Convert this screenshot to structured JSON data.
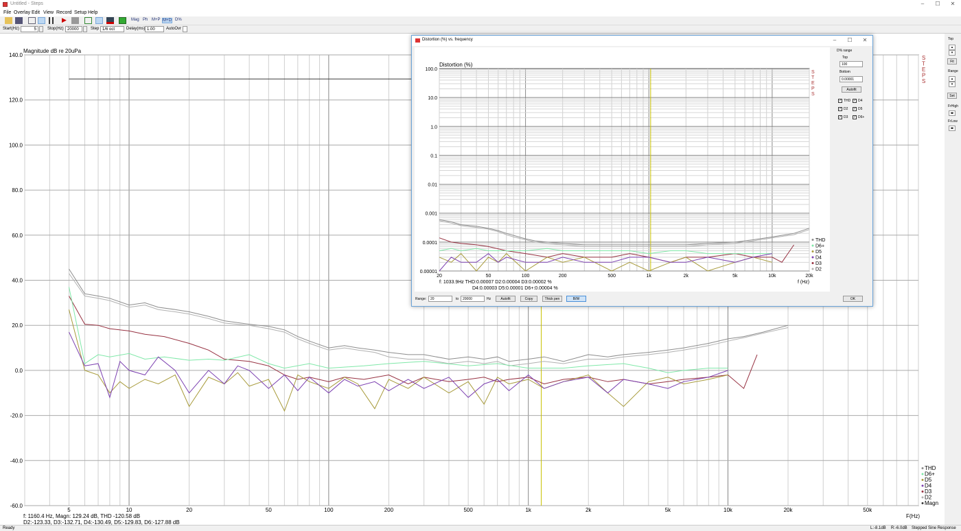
{
  "window": {
    "title": "Untitled - Steps"
  },
  "menu": [
    "File",
    "Overlay",
    "Edit",
    "View",
    "Record",
    "Setup",
    "Help"
  ],
  "toolbar": {
    "mag_label": "Mag",
    "ph_label": "Ph",
    "mp_label": "M+P",
    "md_label": "M+D",
    "pct_label": "D%"
  },
  "params": {
    "start_label": "Start(Hz)",
    "start_value": "5",
    "stop_label": "Stop(Hz)",
    "stop_value": "20000",
    "step_label": "Step",
    "step_value": "1/6 oct",
    "delay_label": "Delay(ms)",
    "delay_value": "1.00",
    "autoovr_label": "AutoOvr"
  },
  "right_panel": {
    "top_label": "Top",
    "fit_label": "Fit",
    "range_label": "Range",
    "set_label": "Set",
    "frhigh_label": "FrHigh",
    "frlow_label": "FrLow"
  },
  "status": {
    "left": "Ready",
    "lvl_l": "L:-8.1dB",
    "lvl_r": "R:-6.0dB",
    "mode": "Stepped Sine Response"
  },
  "colors": {
    "thd": "#8c8c8c",
    "magn": "#3a3a3a",
    "d6": "#7fe8a8",
    "d5": "#a79a3a",
    "d4": "#7b3fb0",
    "d3": "#963040",
    "d2": "#b0b0b0",
    "marker": "#c8c000",
    "steps_logo": "#a33"
  },
  "chart_data": [
    {
      "type": "line",
      "ylabel": "Magnitude dB re 20uPa",
      "xlabel": "F(Hz)",
      "xscale": "log",
      "xlim": [
        3.0,
        90000
      ],
      "ylim": [
        -60,
        140
      ],
      "x_ticks": [
        "5",
        "10",
        "20",
        "50",
        "100",
        "200",
        "500",
        "1k",
        "2k",
        "5k",
        "10k",
        "20k",
        "50k"
      ],
      "y_ticks": [
        "140.0",
        "120.0",
        "100.0",
        "80.0",
        "60.0",
        "40.0",
        "20.0",
        "0.0",
        "-20.0",
        "-40.0",
        "-60.0"
      ],
      "marker_x": 1160.4,
      "legend": [
        "THD",
        "D6+",
        "D5",
        "D4",
        "D3",
        "D2",
        "Magn"
      ],
      "legend_position": "bottom-right",
      "logo": "STEPS",
      "readout_line1": "f: 1160.4 Hz, Magn: 129.24 dB, THD -120.58  dB",
      "readout_line2": "D2:-123.33, D3:-132.71, D4:-130.49, D5:-129.83, D6:-127.88 dB",
      "series": [
        {
          "name": "Magn",
          "x": [
            5,
            10,
            20,
            50,
            100,
            200,
            500,
            1000,
            2000,
            5000,
            10000,
            15000
          ],
          "y": [
            129.3,
            129.3,
            129.3,
            129.3,
            129.3,
            129.3,
            129.3,
            129.3,
            129.3,
            129.3,
            129.3,
            129.3
          ]
        },
        {
          "name": "THD",
          "x": [
            5,
            6,
            7,
            8,
            10,
            12,
            14,
            17,
            20,
            25,
            30,
            40,
            50,
            60,
            70,
            80,
            100,
            120,
            140,
            170,
            200,
            250,
            300,
            400,
            500,
            600,
            700,
            800,
            1000,
            1200,
            1500,
            2000,
            2500,
            3000,
            4000,
            5000,
            6000,
            8000,
            10000,
            12000,
            15000,
            20000
          ],
          "y": [
            45,
            34,
            33,
            32,
            29,
            30,
            28,
            27,
            26,
            24,
            22,
            20.5,
            19.5,
            18,
            15,
            13,
            10,
            11,
            10,
            9,
            8,
            7,
            7,
            5,
            6,
            5,
            6,
            4,
            5,
            6,
            4,
            7,
            6,
            7,
            8,
            9,
            10,
            12,
            14,
            15,
            17,
            20
          ]
        },
        {
          "name": "D2",
          "x": [
            5,
            6,
            7,
            8,
            10,
            12,
            14,
            17,
            20,
            25,
            30,
            40,
            50,
            60,
            70,
            80,
            100,
            120,
            140,
            170,
            200,
            250,
            300,
            400,
            500,
            600,
            700,
            800,
            1000,
            1200,
            1500,
            2000,
            2500,
            3000,
            4000,
            5000,
            6000,
            8000,
            10000,
            12000,
            15000,
            20000
          ],
          "y": [
            43,
            33,
            32,
            31,
            28,
            29,
            27,
            26,
            25,
            23,
            21,
            20,
            18.5,
            17,
            14,
            12,
            9,
            10,
            9,
            8,
            6,
            5,
            5,
            3,
            4,
            3,
            4,
            2,
            3,
            4,
            3,
            5,
            5,
            6,
            7,
            8,
            9,
            11,
            13,
            14.5,
            16.5,
            19
          ]
        },
        {
          "name": "D3",
          "x": [
            5,
            6,
            7,
            8,
            10,
            12,
            15,
            20,
            25,
            30,
            40,
            50,
            60,
            70,
            80,
            100,
            120,
            150,
            200,
            250,
            300,
            400,
            500,
            600,
            700,
            800,
            1000,
            1200,
            1500,
            2000,
            2500,
            3000,
            4000,
            5000,
            6000,
            8000,
            10000,
            12000,
            14000
          ],
          "y": [
            33,
            20.5,
            20,
            18.5,
            17.5,
            16,
            15,
            12,
            9,
            5,
            4,
            2,
            -2,
            -4,
            -3,
            -5,
            -3,
            -4,
            -2,
            -6,
            -3,
            -5,
            -4,
            -3,
            -5,
            -4,
            -3,
            -6,
            -4,
            -3,
            -5,
            -4,
            -6,
            -5,
            -4,
            -3,
            -2,
            -8,
            7
          ]
        },
        {
          "name": "D6+",
          "x": [
            5,
            6,
            7,
            8,
            10,
            12,
            15,
            20,
            25,
            30,
            40,
            50,
            60,
            80,
            100,
            150,
            200,
            300,
            500,
            700,
            1000,
            1500,
            2000,
            3000,
            4000,
            5000,
            6000,
            8000,
            10000
          ],
          "y": [
            37,
            3,
            7,
            6,
            7.5,
            5,
            6,
            4.5,
            5,
            4.5,
            7,
            3,
            1,
            3,
            1,
            2,
            3,
            4,
            2,
            3,
            1,
            1,
            2,
            3,
            1,
            -1,
            0,
            1,
            1
          ]
        },
        {
          "name": "D5",
          "x": [
            5,
            6,
            7,
            8,
            9,
            10,
            12,
            14,
            17,
            20,
            25,
            30,
            35,
            40,
            50,
            60,
            70,
            80,
            100,
            120,
            140,
            170,
            200,
            250,
            300,
            400,
            500,
            600,
            700,
            800,
            1000,
            1200,
            1500,
            2000,
            2500,
            3000,
            4000,
            5000,
            6000,
            8000,
            10000
          ],
          "y": [
            27,
            0,
            -2,
            -10,
            -5,
            -8,
            -4,
            -6,
            -2,
            -16,
            -3,
            -6,
            -1,
            -7,
            -4,
            -18,
            -2,
            -5,
            -8,
            -3,
            -6,
            -17,
            -4,
            -8,
            -3,
            -10,
            -5,
            -15,
            -3,
            -6,
            -4,
            -8,
            -5,
            -2,
            -10,
            -16,
            -5,
            -3,
            -6,
            -4,
            -2
          ]
        },
        {
          "name": "D4",
          "x": [
            5,
            6,
            7,
            8,
            9,
            10,
            12,
            14,
            17,
            20,
            25,
            30,
            35,
            40,
            50,
            60,
            70,
            80,
            100,
            120,
            140,
            170,
            200,
            250,
            300,
            400,
            500,
            600,
            700,
            800,
            1000,
            1200,
            1500,
            2000,
            2500,
            3000,
            4000,
            5000,
            6000,
            8000,
            10000
          ],
          "y": [
            17,
            2,
            3,
            -12,
            4,
            0,
            -2,
            6,
            0,
            -10,
            0,
            -6,
            2,
            0,
            -8,
            -2,
            -9,
            -3,
            -10,
            -4,
            -7,
            -5,
            -9,
            -4,
            -8,
            -3,
            -12,
            -6,
            -4,
            -9,
            -2,
            -8,
            -5,
            -3,
            -10,
            -4,
            -6,
            -8,
            -5,
            -3,
            0
          ]
        }
      ]
    },
    {
      "type": "line",
      "title": "Distortion (%) vs. frequency",
      "ylabel": "Distortion (%)",
      "xlabel": "f (Hz)",
      "xscale": "log",
      "yscale": "log",
      "xlim": [
        20,
        20000
      ],
      "ylim": [
        1e-05,
        100
      ],
      "x_ticks": [
        "20",
        "50",
        "100",
        "200",
        "500",
        "1k",
        "2k",
        "5k",
        "10k",
        "20k"
      ],
      "y_ticks": [
        "100.0",
        "10.0",
        "1.0",
        "0.1",
        "0.01",
        "0.001",
        "0.0001",
        "0.00001"
      ],
      "marker_x": 1033.9,
      "legend": [
        "THD",
        "D6+",
        "D5",
        "D4",
        "D3",
        "D2"
      ],
      "legend_position": "bottom-right",
      "logo": "STEPS",
      "readout_line1": "f: 1033.9Hz       THD:0.00007   D2:0.00004   D3:0.00002 %",
      "readout_line2": "D4:0.00003   D5:0.00001   D6+:0.00004 %",
      "series": [
        {
          "name": "THD",
          "x": [
            20,
            25,
            30,
            40,
            50,
            60,
            70,
            80,
            100,
            120,
            150,
            200,
            300,
            500,
            700,
            1000,
            1500,
            2000,
            3000,
            5000,
            7000,
            10000,
            15000,
            20000
          ],
          "y": [
            0.0006,
            0.0005,
            0.0004,
            0.00035,
            0.0003,
            0.00025,
            0.0002,
            0.00017,
            0.00013,
            0.00011,
            0.0001,
            9e-05,
            8e-05,
            8e-05,
            8e-05,
            8e-05,
            8e-05,
            8e-05,
            9e-05,
            0.0001,
            0.00012,
            0.00015,
            0.0002,
            0.0003
          ]
        },
        {
          "name": "D2",
          "x": [
            20,
            25,
            30,
            40,
            50,
            60,
            70,
            80,
            100,
            120,
            150,
            200,
            300,
            500,
            700,
            1000,
            1500,
            2000,
            3000,
            5000,
            7000,
            10000,
            15000,
            20000
          ],
          "y": [
            0.00055,
            0.00045,
            0.00037,
            0.00032,
            0.00028,
            0.00023,
            0.00018,
            0.00015,
            0.00012,
            0.0001,
            9e-05,
            8e-05,
            7e-05,
            7e-05,
            7e-05,
            7e-05,
            7e-05,
            7e-05,
            8e-05,
            9e-05,
            0.00011,
            0.00014,
            0.00018,
            0.00027
          ]
        },
        {
          "name": "D3",
          "x": [
            20,
            25,
            30,
            40,
            50,
            70,
            100,
            150,
            200,
            300,
            500,
            700,
            1000,
            1500,
            2000,
            3000,
            5000,
            7000,
            10000,
            12000,
            15000
          ],
          "y": [
            0.00014,
            0.0001,
            9e-05,
            8e-05,
            7e-05,
            5e-05,
            4e-05,
            3e-05,
            4e-05,
            3e-05,
            3e-05,
            4e-05,
            3e-05,
            2e-05,
            3e-05,
            3e-05,
            4e-05,
            3e-05,
            3e-05,
            2e-05,
            8e-05
          ]
        },
        {
          "name": "D6+",
          "x": [
            20,
            25,
            30,
            40,
            50,
            70,
            100,
            150,
            200,
            300,
            500,
            700,
            1000,
            1500,
            2000,
            3000,
            5000,
            7000,
            10000
          ],
          "y": [
            5e-05,
            6e-05,
            5e-05,
            6e-05,
            5e-05,
            5e-05,
            5e-05,
            6e-05,
            5e-05,
            5e-05,
            5e-05,
            5e-05,
            4e-05,
            5e-05,
            5e-05,
            4e-05,
            4e-05,
            4e-05,
            4e-05
          ]
        },
        {
          "name": "D5",
          "x": [
            20,
            25,
            30,
            40,
            50,
            60,
            70,
            100,
            150,
            200,
            300,
            500,
            700,
            1000,
            1500,
            2000,
            3000,
            5000,
            7000,
            10000
          ],
          "y": [
            3e-05,
            2e-05,
            4e-05,
            1e-05,
            3e-05,
            2e-05,
            4e-05,
            1e-05,
            3e-05,
            2e-05,
            3e-05,
            1e-05,
            2e-05,
            1e-05,
            2e-05,
            3e-05,
            1e-05,
            2e-05,
            3e-05,
            2e-05
          ]
        },
        {
          "name": "D4",
          "x": [
            20,
            25,
            30,
            40,
            50,
            60,
            70,
            100,
            150,
            200,
            300,
            500,
            700,
            1000,
            1500,
            2000,
            3000,
            5000,
            7000,
            10000
          ],
          "y": [
            1e-05,
            3e-05,
            2e-05,
            2e-05,
            4e-05,
            2e-05,
            3e-05,
            2e-05,
            2e-05,
            3e-05,
            2e-05,
            2e-05,
            3e-05,
            3e-05,
            2e-05,
            2e-05,
            3e-05,
            2e-05,
            3e-05,
            4e-05
          ]
        }
      ]
    }
  ],
  "dialog": {
    "title": "Distortion (%) vs. frequency",
    "range_title": "D% range",
    "top_label": "Top",
    "top_value": "100",
    "bottom_label": "Bottom",
    "bottom_value": "0.00001",
    "autofit_side": "Autofit",
    "checks": [
      "THD",
      "D4",
      "D2",
      "D5",
      "D3",
      "D6+"
    ],
    "range_label": "Range:",
    "range_from": "20",
    "to_label": "to",
    "range_to": "20000",
    "hz_label": "Hz",
    "autofit": "Autofit",
    "copy": "Copy",
    "thick_pen": "Thick pen",
    "bw": "B/W",
    "ok": "OK"
  }
}
